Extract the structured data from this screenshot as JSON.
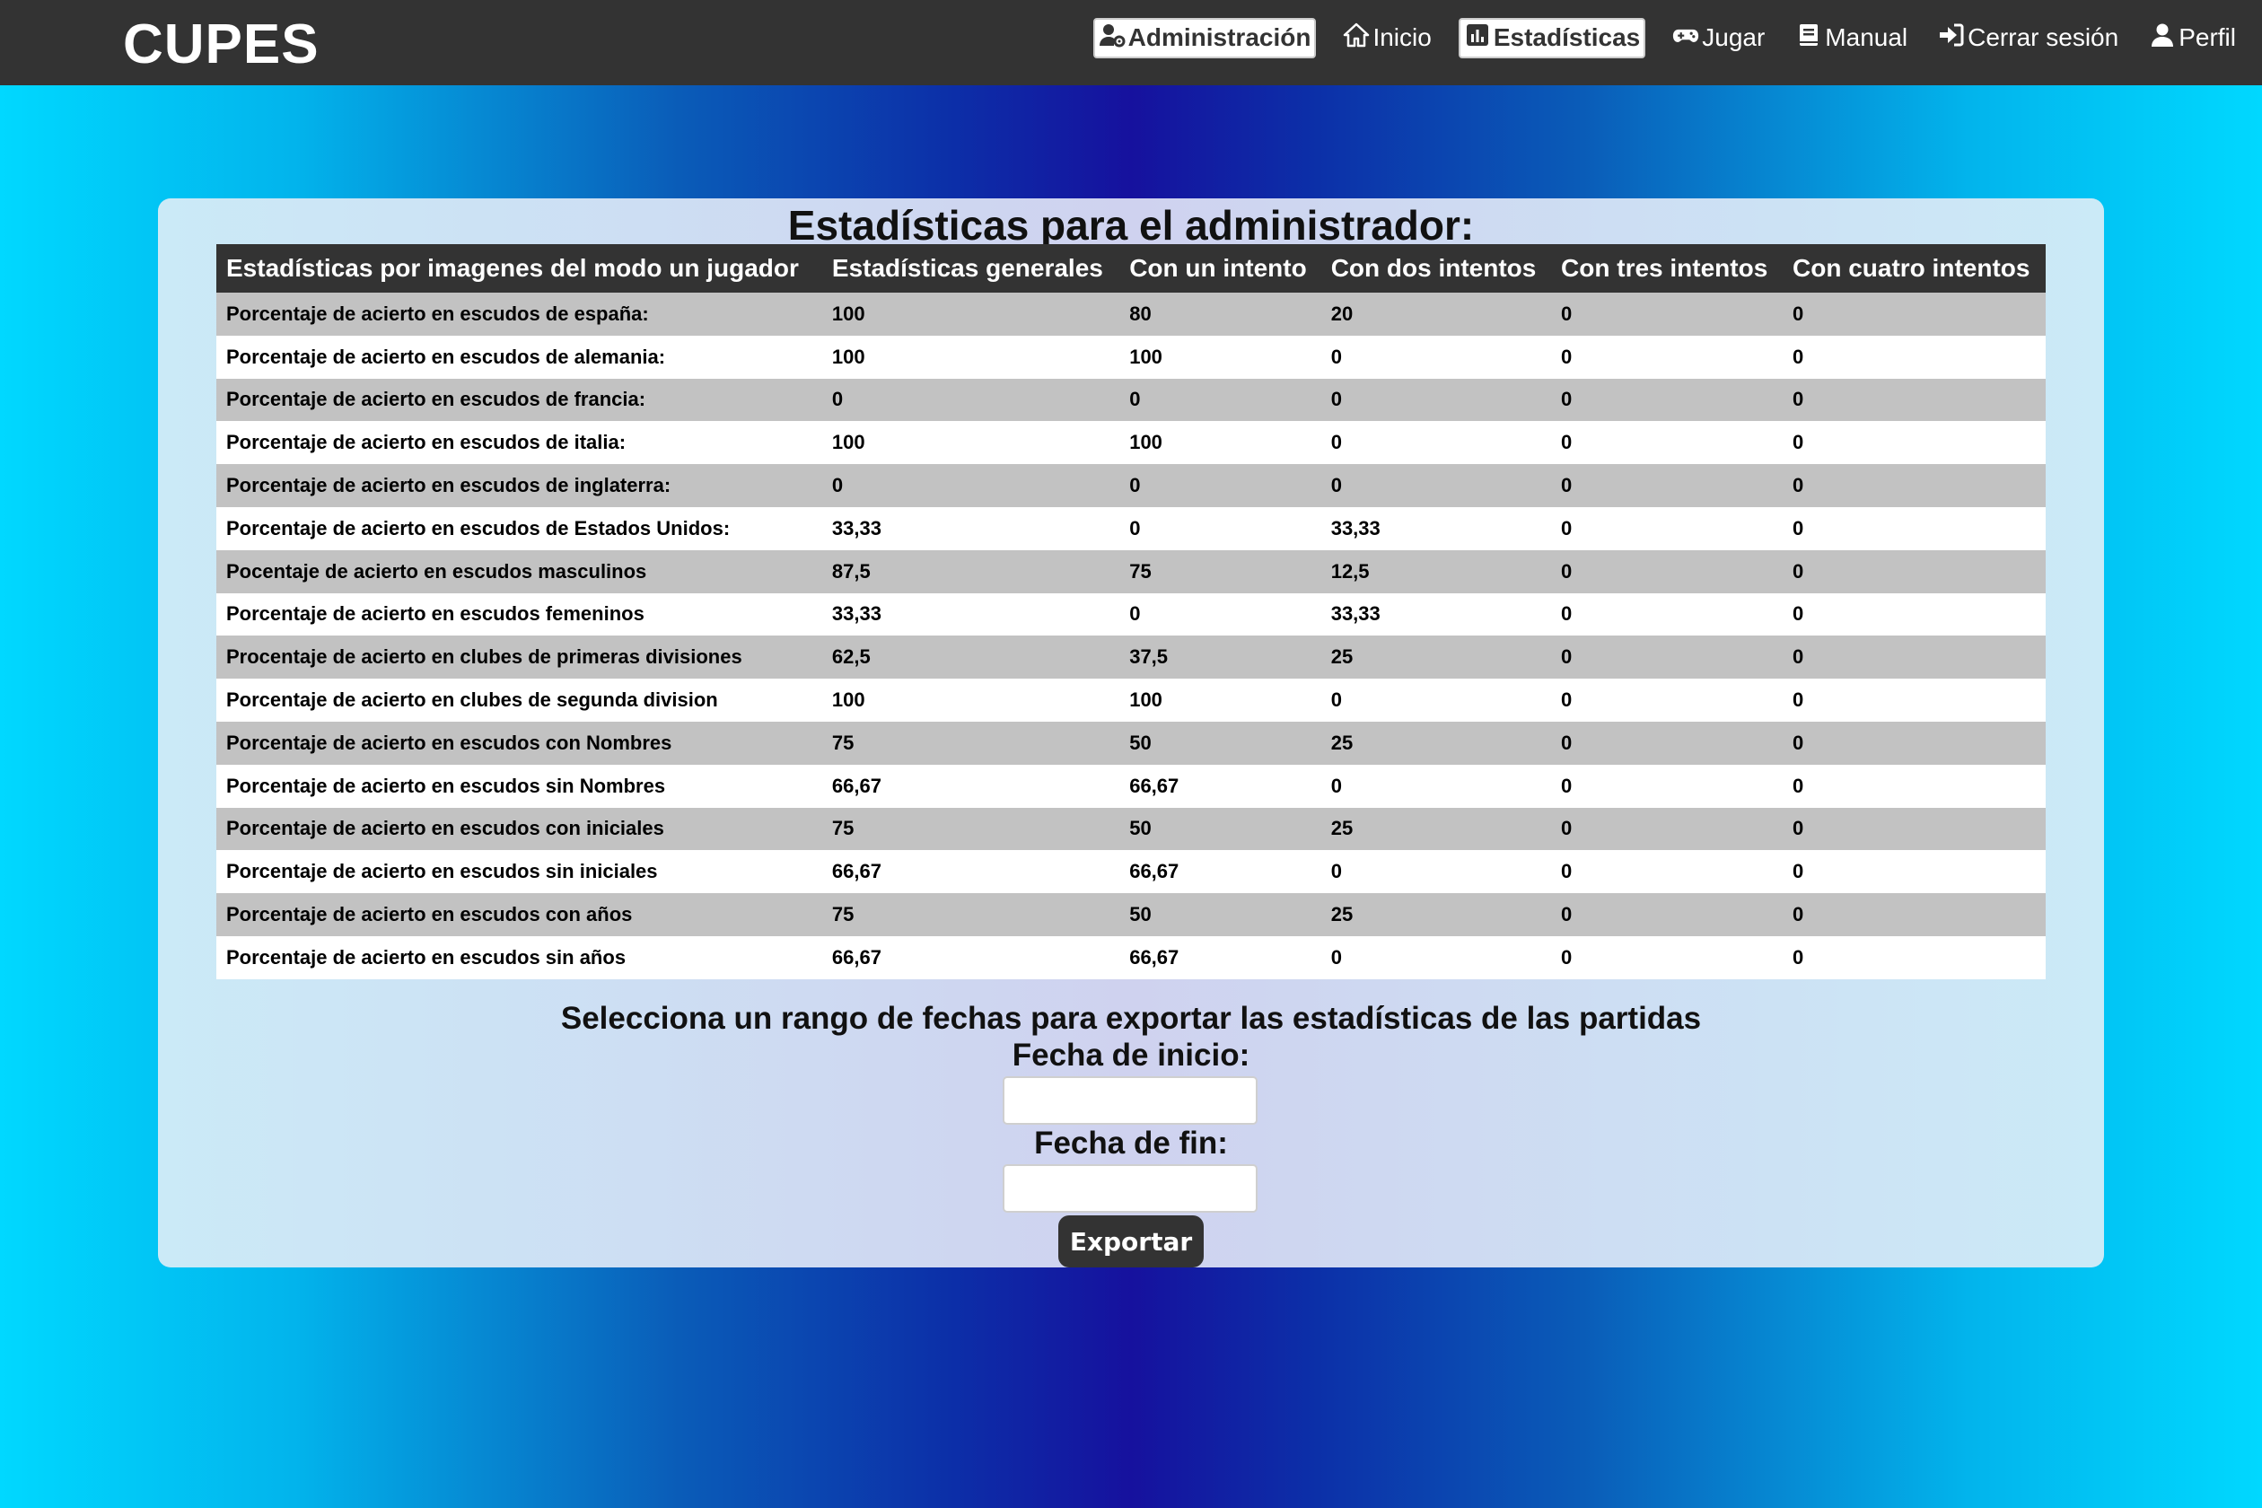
{
  "brand": "CUPES",
  "nav": {
    "items": [
      {
        "label": "Administración",
        "icon": "user-gear-icon",
        "active": true
      },
      {
        "label": "Inicio",
        "icon": "home-icon",
        "active": false
      },
      {
        "label": "Estadísticas",
        "icon": "chart-bar-icon",
        "active": true
      },
      {
        "label": "Jugar",
        "icon": "gamepad-icon",
        "active": false
      },
      {
        "label": "Manual",
        "icon": "book-icon",
        "active": false
      },
      {
        "label": "Cerrar sesión",
        "icon": "sign-out-icon",
        "active": false
      },
      {
        "label": "Perfil",
        "icon": "user-icon",
        "active": false
      }
    ]
  },
  "page_title": "Estadísticas para el administrador:",
  "table": {
    "headers": [
      "Estadísticas por imagenes del modo un jugador",
      "Estadísticas generales",
      "Con un intento",
      "Con dos intentos",
      "Con tres intentos",
      "Con cuatro intentos"
    ],
    "rows": [
      [
        "Porcentaje de acierto en escudos de españa:",
        "100",
        "80",
        "20",
        "0",
        "0"
      ],
      [
        "Porcentaje de acierto en escudos de alemania:",
        "100",
        "100",
        "0",
        "0",
        "0"
      ],
      [
        "Porcentaje de acierto en escudos de francia:",
        "0",
        "0",
        "0",
        "0",
        "0"
      ],
      [
        "Porcentaje de acierto en escudos de italia:",
        "100",
        "100",
        "0",
        "0",
        "0"
      ],
      [
        "Porcentaje de acierto en escudos de inglaterra:",
        "0",
        "0",
        "0",
        "0",
        "0"
      ],
      [
        "Porcentaje de acierto en escudos de Estados Unidos:",
        "33,33",
        "0",
        "33,33",
        "0",
        "0"
      ],
      [
        "Pocentaje de acierto en escudos masculinos",
        "87,5",
        "75",
        "12,5",
        "0",
        "0"
      ],
      [
        "Porcentaje de acierto en escudos femeninos",
        "33,33",
        "0",
        "33,33",
        "0",
        "0"
      ],
      [
        "Procentaje de acierto en clubes de primeras divisiones",
        "62,5",
        "37,5",
        "25",
        "0",
        "0"
      ],
      [
        "Porcentaje de acierto en clubes de segunda division",
        "100",
        "100",
        "0",
        "0",
        "0"
      ],
      [
        "Porcentaje de acierto en escudos con Nombres",
        "75",
        "50",
        "25",
        "0",
        "0"
      ],
      [
        "Porcentaje de acierto en escudos sin Nombres",
        "66,67",
        "66,67",
        "0",
        "0",
        "0"
      ],
      [
        "Porcentaje de acierto en escudos con iniciales",
        "75",
        "50",
        "25",
        "0",
        "0"
      ],
      [
        "Porcentaje de acierto en escudos sin iniciales",
        "66,67",
        "66,67",
        "0",
        "0",
        "0"
      ],
      [
        "Porcentaje de acierto en escudos con años",
        "75",
        "50",
        "25",
        "0",
        "0"
      ],
      [
        "Porcentaje de acierto en escudos sin años",
        "66,67",
        "66,67",
        "0",
        "0",
        "0"
      ]
    ]
  },
  "export": {
    "title": "Selecciona un rango de fechas para exportar las estadísticas de las partidas",
    "start_label": "Fecha de inicio:",
    "start_value": "",
    "end_label": "Fecha de fin:",
    "end_value": "",
    "button_label": "Exportar"
  },
  "colors": {
    "navbar": "#333333",
    "header_row": "#333333",
    "odd_row": "#c2c2c2",
    "even_row": "#ffffff"
  }
}
